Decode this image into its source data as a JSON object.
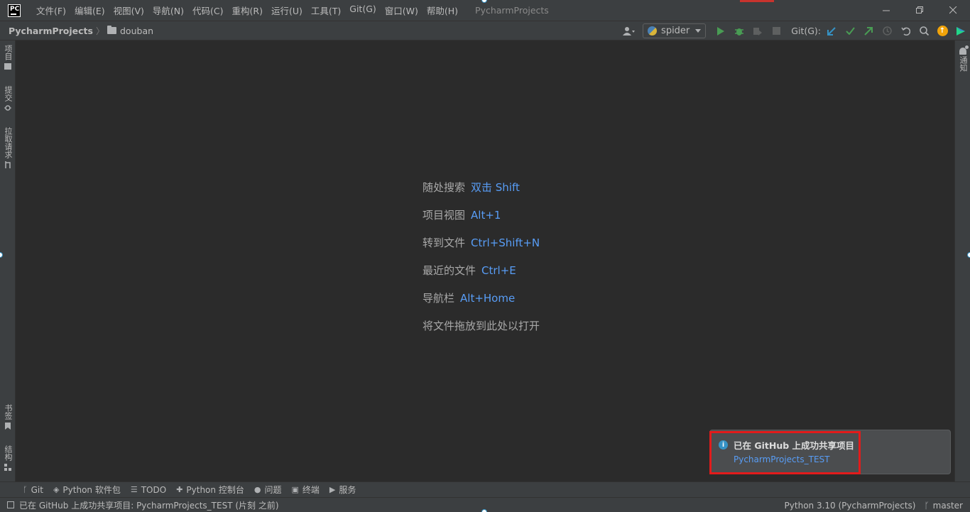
{
  "menu": {
    "items": [
      "文件(F)",
      "编辑(E)",
      "视图(V)",
      "导航(N)",
      "代码(C)",
      "重构(R)",
      "运行(U)",
      "工具(T)",
      "Git(G)",
      "窗口(W)",
      "帮助(H)"
    ],
    "window_title": "PycharmProjects"
  },
  "app": {
    "logo_text": "PC"
  },
  "navbar": {
    "project": "PycharmProjects",
    "folder": "douban",
    "run_config": "spider",
    "git_label": "Git(G):"
  },
  "left_tabs": {
    "project": "项目",
    "commit": "提交",
    "pull_requests": "拉取请求",
    "bookmarks": "书签",
    "structure": "结构"
  },
  "right_tabs": {
    "notifications": "通知"
  },
  "empty_state": {
    "hints": [
      {
        "label": "随处搜索",
        "key": "双击 Shift"
      },
      {
        "label": "项目视图",
        "key": "Alt+1"
      },
      {
        "label": "转到文件",
        "key": "Ctrl+Shift+N"
      },
      {
        "label": "最近的文件",
        "key": "Ctrl+E"
      },
      {
        "label": "导航栏",
        "key": "Alt+Home"
      },
      {
        "label": "将文件拖放到此处以打开",
        "key": ""
      }
    ]
  },
  "notification": {
    "title": "已在 GitHub 上成功共享项目",
    "link": "PycharmProjects_TEST"
  },
  "tool_windows": [
    "Git",
    "Python 软件包",
    "TODO",
    "Python 控制台",
    "问题",
    "终端",
    "服务"
  ],
  "status": {
    "message": "已在 GitHub 上成功共享项目: PycharmProjects_TEST (片刻 之前)",
    "interpreter": "Python 3.10 (PycharmProjects)",
    "branch": "master"
  },
  "colors": {
    "background": "#2b2b2b",
    "panel": "#3c3f41",
    "link": "#589df6",
    "highlight_box": "#e21b1b",
    "run_green": "#499c54"
  }
}
